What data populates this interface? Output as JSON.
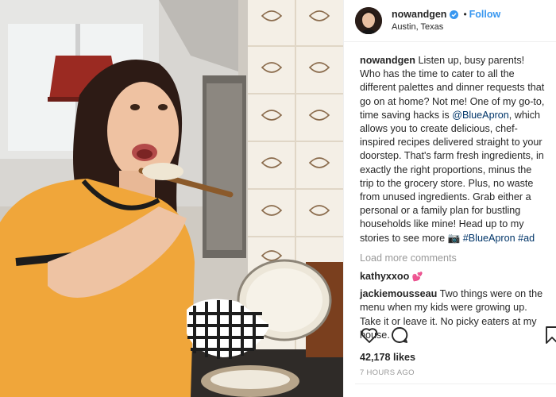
{
  "post": {
    "username": "nowandgen",
    "follow_label": "Follow",
    "dot": "•",
    "location": "Austin, Texas",
    "caption": {
      "user": "nowandgen",
      "text_1": " Listen up, busy parents! Who has the time to cater to all the different palettes and dinner requests that go on at home? Not me! One of my go-to, time saving hacks is ",
      "mention": "@BlueApron",
      "text_2": ", which allows you to create delicious, chef-inspired recipes delivered straight to your doorstep. That's farm fresh ingredients, in exactly the right proportions, minus the trip to the grocery store. Plus, no waste from unused ingredients. Grab either a personal or a family plan for bustling households like mine! Head up to my stories to see more ",
      "emoji": "📷",
      "hashtag_1": "#BlueApron",
      "hashtag_2": "#ad"
    },
    "load_more": "Load more comments",
    "comments": [
      {
        "user": "kathyxxoo",
        "text": "",
        "emoji": "💕"
      },
      {
        "user": "jackiemousseau",
        "text": " Two things were on the menu when my kids were growing up. Take it or leave it. No picky eaters at my house."
      }
    ],
    "likes": "42,178 likes",
    "time": "7 HOURS AGO"
  },
  "icons": {
    "verified": "verified-badge-icon",
    "like": "heart-icon",
    "comment": "comment-bubble-icon",
    "save": "bookmark-icon"
  },
  "colors": {
    "link": "#3897f0",
    "mention": "#003569",
    "muted": "#999999",
    "shirt": "#f0a63a"
  }
}
